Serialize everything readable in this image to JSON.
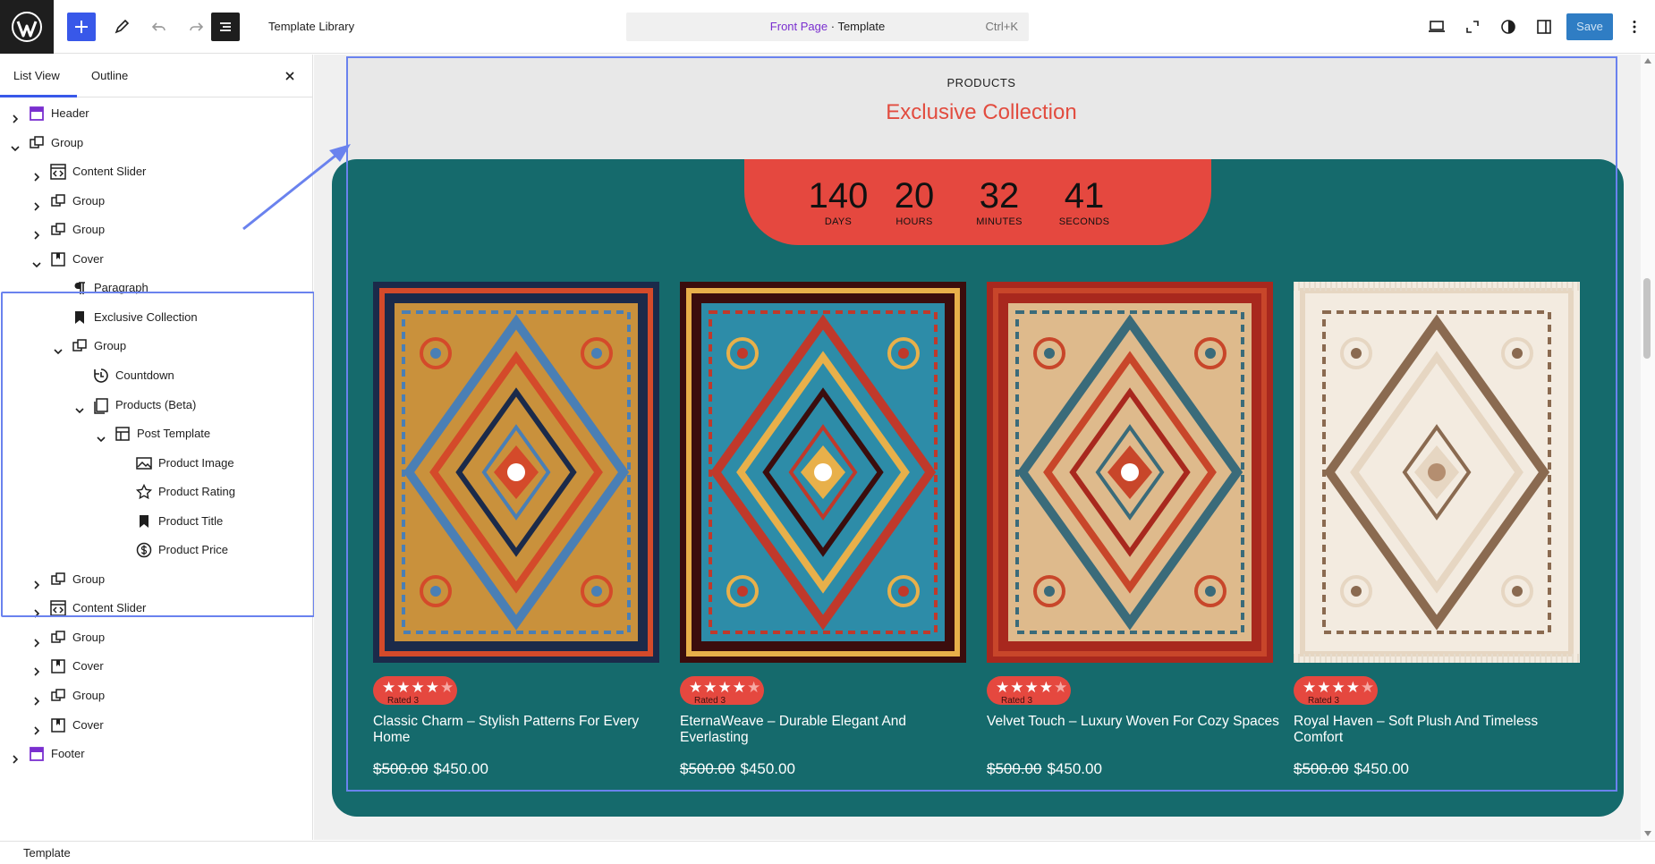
{
  "topbar": {
    "title": "Template Library",
    "command": {
      "page": "Front Page",
      "separator": " · ",
      "kind": "Template",
      "shortcut": "Ctrl+K"
    },
    "save_label": "Save"
  },
  "sidebar": {
    "tabs": [
      {
        "label": "List View"
      },
      {
        "label": "Outline"
      }
    ],
    "tree": [
      {
        "label": "Header",
        "icon": "template-part-icon"
      },
      {
        "label": "Group",
        "icon": "group-icon"
      },
      {
        "label": "Content Slider",
        "icon": "slider-icon"
      },
      {
        "label": "Group",
        "icon": "group-icon"
      },
      {
        "label": "Group",
        "icon": "group-icon"
      },
      {
        "label": "Cover",
        "icon": "cover-icon"
      },
      {
        "label": "Paragraph",
        "icon": "paragraph-icon"
      },
      {
        "label": "Exclusive Collection",
        "icon": "bookmark-icon"
      },
      {
        "label": "Group",
        "icon": "group-icon"
      },
      {
        "label": "Countdown",
        "icon": "countdown-icon"
      },
      {
        "label": "Products (Beta)",
        "icon": "products-icon"
      },
      {
        "label": "Post Template",
        "icon": "layout-icon"
      },
      {
        "label": "Product Image",
        "icon": "image-icon"
      },
      {
        "label": "Product Rating",
        "icon": "star-icon"
      },
      {
        "label": "Product Title",
        "icon": "bookmark-icon"
      },
      {
        "label": "Product Price",
        "icon": "price-icon"
      },
      {
        "label": "Group",
        "icon": "group-icon"
      },
      {
        "label": "Content Slider",
        "icon": "slider-icon"
      },
      {
        "label": "Group",
        "icon": "group-icon"
      },
      {
        "label": "Cover",
        "icon": "cover-icon"
      },
      {
        "label": "Group",
        "icon": "group-icon"
      },
      {
        "label": "Cover",
        "icon": "cover-icon"
      },
      {
        "label": "Footer",
        "icon": "template-part-icon"
      }
    ]
  },
  "footer": {
    "breadcrumb": "Template"
  },
  "preview": {
    "kicker": "PRODUCTS",
    "heading": "Exclusive Collection",
    "countdown": [
      {
        "value": "140",
        "label": "DAYS"
      },
      {
        "value": "20",
        "label": "HOURS"
      },
      {
        "value": "32",
        "label": "MINUTES"
      },
      {
        "value": "41",
        "label": "SECONDS"
      }
    ],
    "products": [
      {
        "title": "Classic Charm – Stylish Patterns For Every Home",
        "old_price": "$500.00",
        "price": "$450.00",
        "rating": 4,
        "rating_text": "Rated 3",
        "palette": [
          "#1b2a4a",
          "#e8a33a",
          "#4a7fb5",
          "#d44a2a"
        ]
      },
      {
        "title": "EternaWeave – Durable Elegant And Everlasting",
        "old_price": "$500.00",
        "price": "$450.00",
        "rating": 4,
        "rating_text": "Rated 3",
        "palette": [
          "#3b0d0d",
          "#2ba3c4",
          "#c0392b",
          "#e8b04a"
        ]
      },
      {
        "title": "Velvet Touch – Luxury Woven For Cozy Spaces",
        "old_price": "$500.00",
        "price": "$450.00",
        "rating": 4,
        "rating_text": "Rated 3",
        "palette": [
          "#a8281e",
          "#e8d3a0",
          "#3a6b7a",
          "#c8462a"
        ]
      },
      {
        "title": "Royal Haven – Soft Plush And Timeless Comfort",
        "old_price": "$500.00",
        "price": "$450.00",
        "rating": 4,
        "rating_text": "Rated 3",
        "palette": [
          "#f3ebe0",
          "#c9a88a",
          "#8a6a50",
          "#e6d6c2"
        ]
      }
    ]
  },
  "colors": {
    "accent": "#3858e9",
    "brand_red": "#e5483f",
    "teal": "#156a6c"
  }
}
